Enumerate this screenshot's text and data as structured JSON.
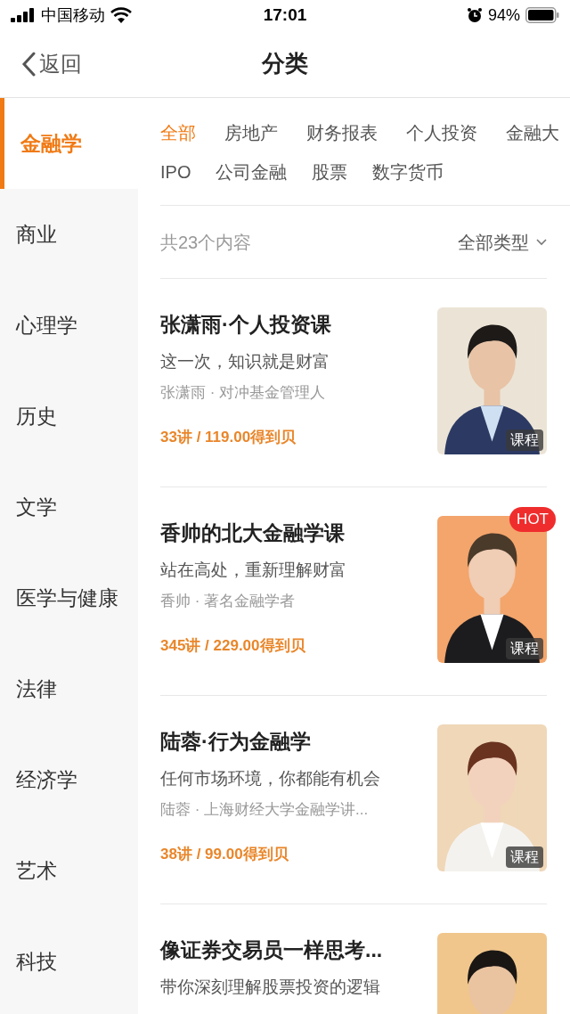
{
  "status_bar": {
    "carrier": "中国移动",
    "time": "17:01",
    "battery": "94%"
  },
  "nav": {
    "back": "返回",
    "title": "分类"
  },
  "sidebar": {
    "items": [
      {
        "label": "金融学",
        "selected": true
      },
      {
        "label": "商业",
        "selected": false
      },
      {
        "label": "心理学",
        "selected": false
      },
      {
        "label": "历史",
        "selected": false
      },
      {
        "label": "文学",
        "selected": false
      },
      {
        "label": "医学与健康",
        "selected": false
      },
      {
        "label": "法律",
        "selected": false
      },
      {
        "label": "经济学",
        "selected": false
      },
      {
        "label": "艺术",
        "selected": false
      },
      {
        "label": "科技",
        "selected": false
      }
    ]
  },
  "tags": [
    [
      {
        "label": "全部",
        "selected": true
      },
      {
        "label": "房地产",
        "selected": false
      },
      {
        "label": "财务报表",
        "selected": false
      },
      {
        "label": "个人投资",
        "selected": false
      },
      {
        "label": "金融大",
        "selected": false
      }
    ],
    [
      {
        "label": "IPO",
        "selected": false
      },
      {
        "label": "公司金融",
        "selected": false
      },
      {
        "label": "股票",
        "selected": false
      },
      {
        "label": "数字货币",
        "selected": false
      }
    ]
  ],
  "summary": {
    "count": "共23个内容",
    "filter": "全部类型"
  },
  "courses": [
    {
      "title": "张潇雨·个人投资课",
      "subtitle": "这一次，知识就是财富",
      "author": "张潇雨 · 对冲基金管理人",
      "price": "33讲 / 119.00得到贝",
      "badge": "课程"
    },
    {
      "title": "香帅的北大金融学课",
      "subtitle": "站在高处，重新理解财富",
      "author": "香帅 · 著名金融学者",
      "price": "345讲 / 229.00得到贝",
      "badge": "课程",
      "flag": "HOT"
    },
    {
      "title": "陆蓉·行为金融学",
      "subtitle": "任何市场环境，你都能有机会",
      "author": "陆蓉 · 上海财经大学金融学讲...",
      "price": "38讲 / 99.00得到贝",
      "badge": "课程"
    },
    {
      "title": "像证券交易员一样思考...",
      "subtitle": "带你深刻理解股票投资的逻辑"
    }
  ]
}
